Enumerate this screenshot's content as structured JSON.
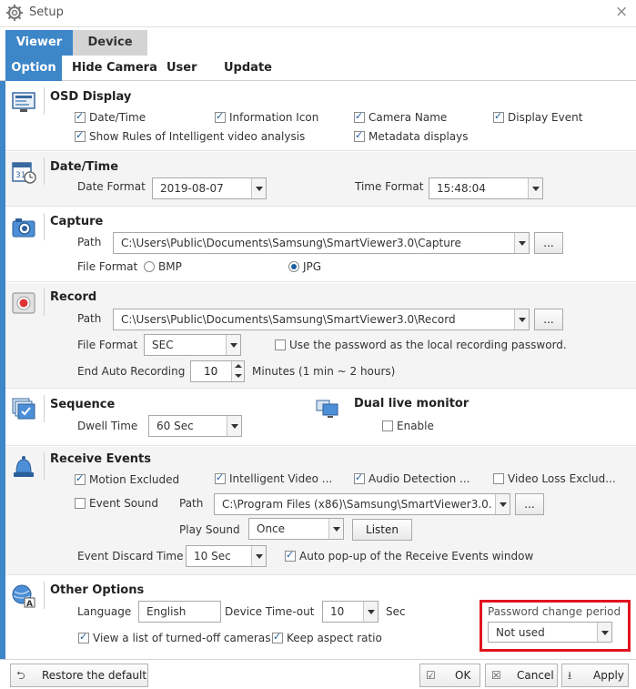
{
  "window": {
    "title": "Setup",
    "close_glyph": "×"
  },
  "tabs_main": [
    {
      "label": "Viewer"
    },
    {
      "label": "Device"
    }
  ],
  "tabs_sub": [
    {
      "label": "Option"
    },
    {
      "label": "Hide Camera"
    },
    {
      "label": "User"
    },
    {
      "label": "Update"
    }
  ],
  "osd": {
    "title": "OSD Display",
    "items": [
      {
        "label": "Date/Time",
        "checked": true
      },
      {
        "label": "Information Icon",
        "checked": true
      },
      {
        "label": "Camera Name",
        "checked": true
      },
      {
        "label": "Display Event",
        "checked": true
      },
      {
        "label": "Show Rules of Intelligent video analysis",
        "checked": true
      },
      {
        "label": "Metadata displays",
        "checked": true
      }
    ]
  },
  "datetime": {
    "title": "Date/Time",
    "date_format_label": "Date Format",
    "date_format_value": "2019-08-07",
    "time_format_label": "Time Format",
    "time_format_value": "15:48:04"
  },
  "capture": {
    "title": "Capture",
    "path_label": "Path",
    "path_value": "C:\\Users\\Public\\Documents\\Samsung\\SmartViewer3.0\\Capture",
    "browse_label": "...",
    "file_format_label": "File Format",
    "options": [
      {
        "label": "BMP",
        "selected": false
      },
      {
        "label": "JPG",
        "selected": true
      }
    ]
  },
  "record": {
    "title": "Record",
    "path_label": "Path",
    "path_value": "C:\\Users\\Public\\Documents\\Samsung\\SmartViewer3.0\\Record",
    "browse_label": "...",
    "file_format_label": "File Format",
    "file_format_value": "SEC",
    "password_label": "Use the password as the local recording password.",
    "end_auto_label": "End Auto Recording",
    "end_auto_value": "10",
    "minutes_label": "Minutes (1 min ~ 2 hours)"
  },
  "sequence": {
    "title": "Sequence",
    "dwell_label": "Dwell Time",
    "dwell_value": "60 Sec"
  },
  "dual_monitor": {
    "title": "Dual live monitor",
    "enable_label": "Enable"
  },
  "receive_events": {
    "title": "Receive Events",
    "items": [
      {
        "label": "Motion Excluded",
        "checked": true
      },
      {
        "label": "Intelligent Video ...",
        "checked": true
      },
      {
        "label": "Audio Detection ...",
        "checked": true
      },
      {
        "label": "Video Loss Exclud...",
        "checked": false
      }
    ],
    "event_sound_label": "Event Sound",
    "path_label": "Path",
    "path_value": "C:\\Program Files (x86)\\Samsung\\SmartViewer3.0...",
    "browse_label": "...",
    "play_sound_label": "Play Sound",
    "play_sound_value": "Once",
    "listen_label": "Listen",
    "discard_label": "Event Discard Time",
    "discard_value": "10 Sec",
    "auto_popup_label": "Auto pop-up of the Receive Events window"
  },
  "other": {
    "title": "Other Options",
    "language_label": "Language",
    "language_value": "English",
    "timeout_label": "Device Time-out",
    "timeout_value": "10",
    "timeout_unit": "Sec",
    "password_period_label": "Password change period",
    "password_period_value": "Not used",
    "turned_off_label": "View a list of turned-off cameras",
    "aspect_label": "Keep aspect ratio"
  },
  "footer": {
    "restore_label": "Restore the default",
    "ok_label": "OK",
    "cancel_label": "Cancel",
    "apply_label": "Apply"
  },
  "colors": {
    "accent": "#3d86c8",
    "highlight": "#e0141e"
  }
}
